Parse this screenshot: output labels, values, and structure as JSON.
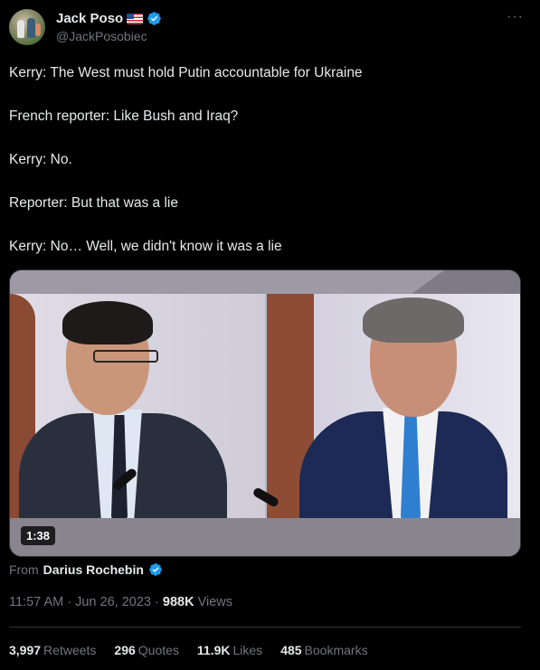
{
  "author": {
    "display_name": "Jack Poso",
    "handle": "@JackPosobiec",
    "flag_icon": "us-flag-icon",
    "verified_icon": "verified-badge-icon"
  },
  "more_label": "···",
  "tweet_lines": [
    "Kerry: The West must hold Putin accountable for Ukraine",
    "French reporter: Like Bush and Iraq?",
    "Kerry: No.",
    "Reporter: But that was a lie",
    "Kerry: No… Well, we didn't know it was a lie"
  ],
  "media": {
    "duration": "1:38"
  },
  "from": {
    "prefix": "From",
    "name": "Darius Rochebin"
  },
  "meta": {
    "time": "11:57 AM",
    "date": "Jun 26, 2023",
    "views_count": "988K",
    "views_label": "Views",
    "separator": "·"
  },
  "stats": {
    "retweets": {
      "count": "3,997",
      "label": "Retweets"
    },
    "quotes": {
      "count": "296",
      "label": "Quotes"
    },
    "likes": {
      "count": "11.9K",
      "label": "Likes"
    },
    "bookmarks": {
      "count": "485",
      "label": "Bookmarks"
    }
  },
  "colors": {
    "background": "#000000",
    "text": "#e7e9ea",
    "muted": "#71767b",
    "verified": "#1d9bf0",
    "divider": "#2f3336"
  }
}
